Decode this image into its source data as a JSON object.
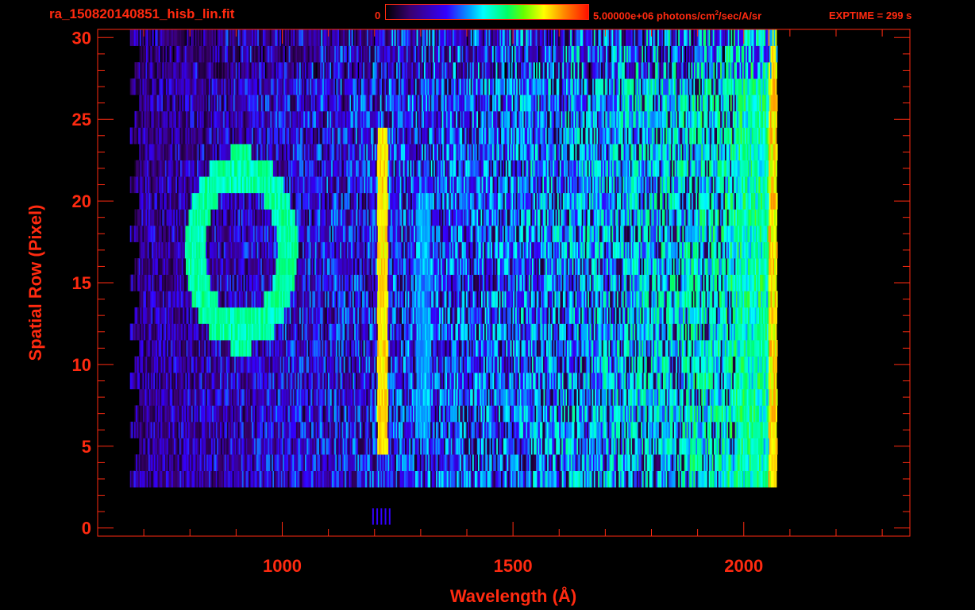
{
  "header": {
    "filename": "ra_150820140851_hisb_lin.fit",
    "colorbar_min": "0",
    "colorbar_max_value": "5.00000e+06 photons/cm",
    "colorbar_max_exp": "2",
    "colorbar_max_tail": "/sec/A/sr",
    "exptime": "EXPTIME = 299 s"
  },
  "colors": {
    "axis": "#ff2a10",
    "background": "#000000"
  },
  "chart_data": {
    "type": "heatmap",
    "xlabel": "Wavelength (Å)",
    "ylabel": "Spatial Row (Pixel)",
    "xlim": [
      600,
      2360
    ],
    "ylim": [
      -0.5,
      30.5
    ],
    "x_ticks": [
      1000,
      1500,
      2000
    ],
    "y_ticks": [
      0,
      5,
      10,
      15,
      20,
      25,
      30
    ],
    "x_minor_step": 100,
    "y_minor_step": 1,
    "colorbar": {
      "min": 0,
      "max": 5000000,
      "units": "photons/cm^2/sec/A/sr"
    },
    "data_extent": {
      "x": [
        680,
        2070
      ],
      "y": [
        3,
        30
      ]
    },
    "features": [
      {
        "name": "Lyman-alpha line",
        "x": 1216,
        "y_range": [
          5,
          24
        ],
        "peak_level": 0.85
      },
      {
        "name": "ring emission",
        "center": [
          910,
          17
        ],
        "x_radius": 100,
        "y_radius": 5,
        "level": 0.55
      },
      {
        "name": "secondary line",
        "x": 1304,
        "y_range": [
          6,
          20
        ],
        "level": 0.4
      },
      {
        "name": "red edge",
        "x": 2060,
        "y_range": [
          2,
          30
        ],
        "level": 0.8
      }
    ]
  }
}
